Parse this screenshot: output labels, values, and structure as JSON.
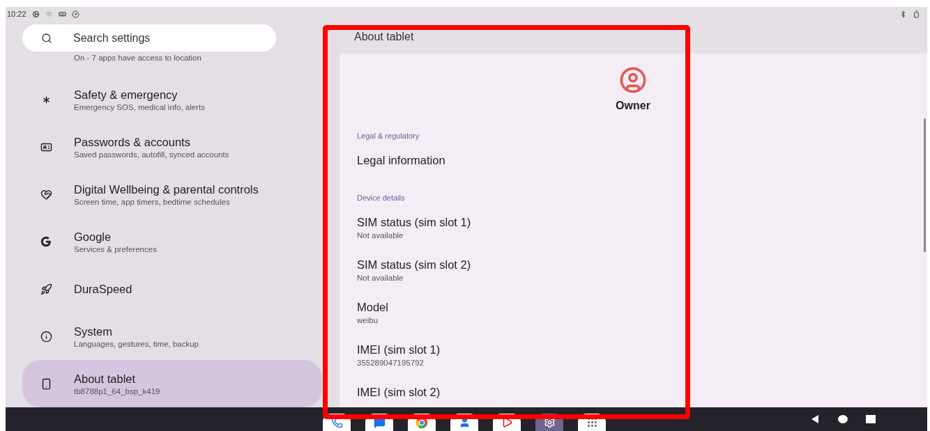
{
  "status_bar": {
    "time": "10:22"
  },
  "search": {
    "placeholder": "Search settings"
  },
  "sidebar": {
    "items": [
      {
        "summary": "On - 7 apps have access to location",
        "selected": false
      },
      {
        "title": "Safety & emergency",
        "summary": "Emergency SOS, medical info, alerts",
        "selected": false
      },
      {
        "title": "Passwords & accounts",
        "summary": "Saved passwords, autofill, synced accounts",
        "selected": false
      },
      {
        "title": "Digital Wellbeing & parental controls",
        "summary": "Screen time, app timers, bedtime schedules",
        "selected": false
      },
      {
        "title": "Google",
        "summary": "Services & preferences",
        "selected": false
      },
      {
        "title": "DuraSpeed",
        "selected": false
      },
      {
        "title": "System",
        "summary": "Languages, gestures, time, backup",
        "selected": false
      },
      {
        "title": "About tablet",
        "summary": "tb8788p1_64_bsp_k419",
        "selected": true
      }
    ]
  },
  "detail": {
    "title": "About tablet",
    "user": "Owner",
    "rows": [
      {
        "kind": "category",
        "title": "Legal & regulatory"
      },
      {
        "kind": "pref",
        "title": "Legal information"
      },
      {
        "kind": "category",
        "title": "Device details"
      },
      {
        "kind": "pref",
        "title": "SIM status (sim slot 1)",
        "summary": "Not available"
      },
      {
        "kind": "pref",
        "title": "SIM status (sim slot 2)",
        "summary": "Not available"
      },
      {
        "kind": "pref",
        "title": "Model",
        "summary": "weibu"
      },
      {
        "kind": "pref",
        "title": "IMEI (sim slot 1)",
        "summary": "355289047195792"
      },
      {
        "kind": "pref",
        "title": "IMEI (sim slot 2)"
      }
    ]
  },
  "dock": [
    {
      "selected": false
    },
    {
      "selected": false
    },
    {
      "selected": false
    },
    {
      "selected": false
    },
    {
      "selected": false
    },
    {
      "selected": true
    },
    {
      "selected": false
    }
  ]
}
